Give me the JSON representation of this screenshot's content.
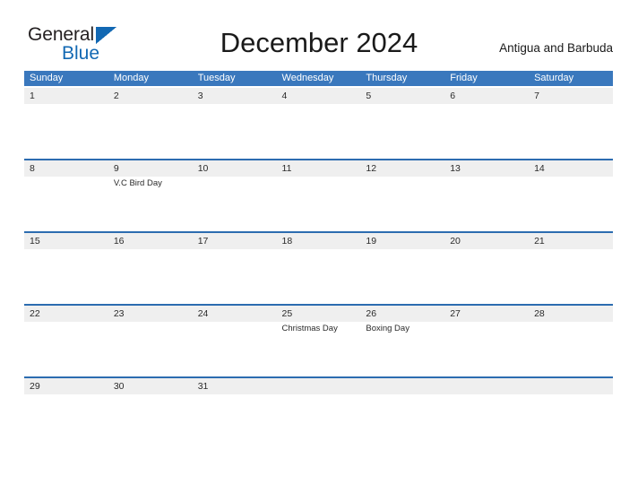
{
  "brand": {
    "name_part1": "General",
    "name_part2": "Blue",
    "flag_icon": "flag-triangle-icon",
    "color": "#1268b3"
  },
  "header": {
    "title": "December 2024",
    "country": "Antigua and Barbuda"
  },
  "theme": {
    "header_blue": "#3a78bd",
    "rule_blue": "#2c6cb0",
    "strip_gray": "#efefef",
    "text_dark": "#2a2a2a"
  },
  "calendar": {
    "weekdays": [
      "Sunday",
      "Monday",
      "Tuesday",
      "Wednesday",
      "Thursday",
      "Friday",
      "Saturday"
    ],
    "weeks": [
      [
        {
          "day": "1",
          "event": ""
        },
        {
          "day": "2",
          "event": ""
        },
        {
          "day": "3",
          "event": ""
        },
        {
          "day": "4",
          "event": ""
        },
        {
          "day": "5",
          "event": ""
        },
        {
          "day": "6",
          "event": ""
        },
        {
          "day": "7",
          "event": ""
        }
      ],
      [
        {
          "day": "8",
          "event": ""
        },
        {
          "day": "9",
          "event": "V.C Bird Day"
        },
        {
          "day": "10",
          "event": ""
        },
        {
          "day": "11",
          "event": ""
        },
        {
          "day": "12",
          "event": ""
        },
        {
          "day": "13",
          "event": ""
        },
        {
          "day": "14",
          "event": ""
        }
      ],
      [
        {
          "day": "15",
          "event": ""
        },
        {
          "day": "16",
          "event": ""
        },
        {
          "day": "17",
          "event": ""
        },
        {
          "day": "18",
          "event": ""
        },
        {
          "day": "19",
          "event": ""
        },
        {
          "day": "20",
          "event": ""
        },
        {
          "day": "21",
          "event": ""
        }
      ],
      [
        {
          "day": "22",
          "event": ""
        },
        {
          "day": "23",
          "event": ""
        },
        {
          "day": "24",
          "event": ""
        },
        {
          "day": "25",
          "event": "Christmas Day"
        },
        {
          "day": "26",
          "event": "Boxing Day"
        },
        {
          "day": "27",
          "event": ""
        },
        {
          "day": "28",
          "event": ""
        }
      ],
      [
        {
          "day": "29",
          "event": ""
        },
        {
          "day": "30",
          "event": ""
        },
        {
          "day": "31",
          "event": ""
        },
        {
          "day": "",
          "event": ""
        },
        {
          "day": "",
          "event": ""
        },
        {
          "day": "",
          "event": ""
        },
        {
          "day": "",
          "event": ""
        }
      ]
    ]
  }
}
